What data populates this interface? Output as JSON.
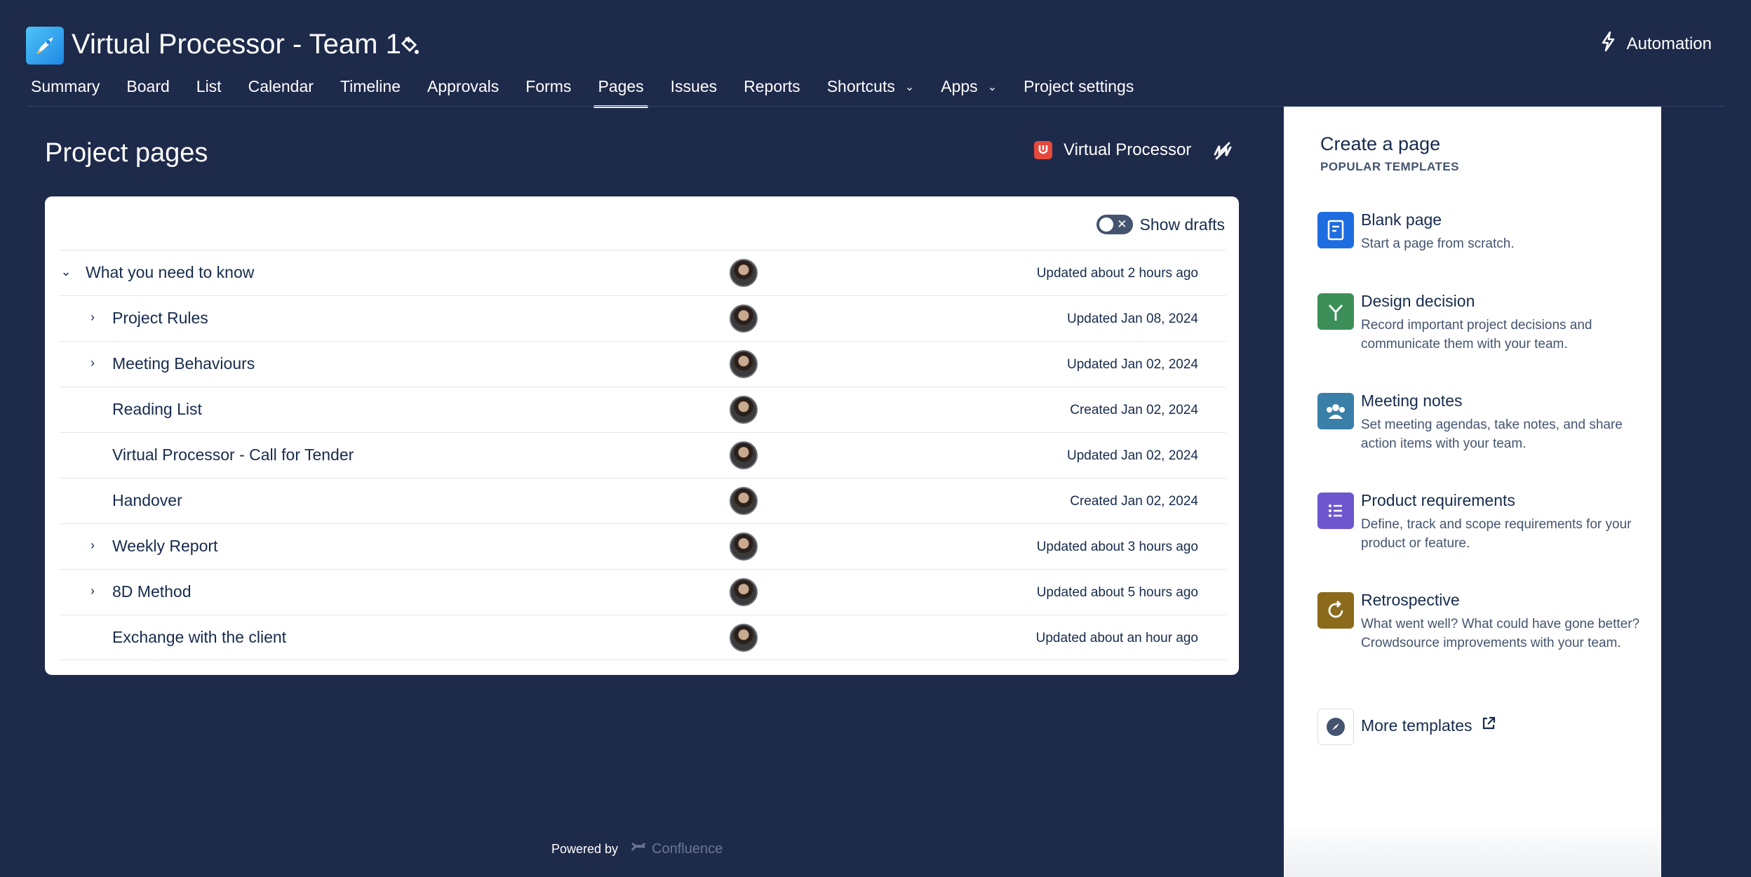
{
  "header": {
    "project_title": "Virtual Processor - Team 1",
    "automation_label": "Automation",
    "nav": [
      {
        "label": "Summary"
      },
      {
        "label": "Board"
      },
      {
        "label": "List"
      },
      {
        "label": "Calendar"
      },
      {
        "label": "Timeline"
      },
      {
        "label": "Approvals"
      },
      {
        "label": "Forms"
      },
      {
        "label": "Pages",
        "active": true
      },
      {
        "label": "Issues"
      },
      {
        "label": "Reports"
      },
      {
        "label": "Shortcuts",
        "dropdown": true
      },
      {
        "label": "Apps",
        "dropdown": true
      },
      {
        "label": "Project settings"
      }
    ]
  },
  "main": {
    "title": "Project pages",
    "space_name": "Virtual Processor",
    "show_drafts_label": "Show drafts",
    "pages": [
      {
        "name": "What you need to know",
        "expander": "expanded",
        "indent": 0,
        "status": "Updated about 2 hours ago"
      },
      {
        "name": "Project Rules",
        "expander": "collapsed",
        "indent": 1,
        "status": "Updated Jan 08, 2024"
      },
      {
        "name": "Meeting Behaviours",
        "expander": "collapsed",
        "indent": 1,
        "status": "Updated Jan 02, 2024"
      },
      {
        "name": "Reading List",
        "expander": "none",
        "indent": 1,
        "status": "Created Jan 02, 2024"
      },
      {
        "name": "Virtual Processor - Call for Tender",
        "expander": "none",
        "indent": 1,
        "status": "Updated Jan 02, 2024"
      },
      {
        "name": "Handover",
        "expander": "none",
        "indent": 1,
        "status": "Created Jan 02, 2024"
      },
      {
        "name": "Weekly Report",
        "expander": "collapsed",
        "indent": 1,
        "status": "Updated about 3 hours ago"
      },
      {
        "name": "8D Method",
        "expander": "collapsed",
        "indent": 1,
        "status": "Updated about 5 hours ago"
      },
      {
        "name": "Exchange with the client",
        "expander": "none",
        "indent": 1,
        "status": "Updated about an hour ago"
      }
    ]
  },
  "footer": {
    "powered_by": "Powered by",
    "brand": "Confluence"
  },
  "sidebar": {
    "title": "Create a page",
    "subtitle": "POPULAR TEMPLATES",
    "templates": [
      {
        "name": "Blank page",
        "desc": "Start a page from scratch.",
        "color": "#1d6ce0",
        "icon": "document-icon"
      },
      {
        "name": "Design decision",
        "desc": "Record important project decisions and communicate them with your team.",
        "color": "#3d8f5a",
        "icon": "branch-icon"
      },
      {
        "name": "Meeting notes",
        "desc": "Set meeting agendas, take notes, and share action items with your team.",
        "color": "#3a7fa8",
        "icon": "people-icon"
      },
      {
        "name": "Product requirements",
        "desc": "Define, track and scope requirements for your product or feature.",
        "color": "#6e56cf",
        "icon": "list-icon"
      },
      {
        "name": "Retrospective",
        "desc": "What went well? What could have gone better? Crowdsource improvements with your team.",
        "color": "#8c6a1c",
        "icon": "loop-icon"
      }
    ],
    "more_label": "More templates"
  }
}
